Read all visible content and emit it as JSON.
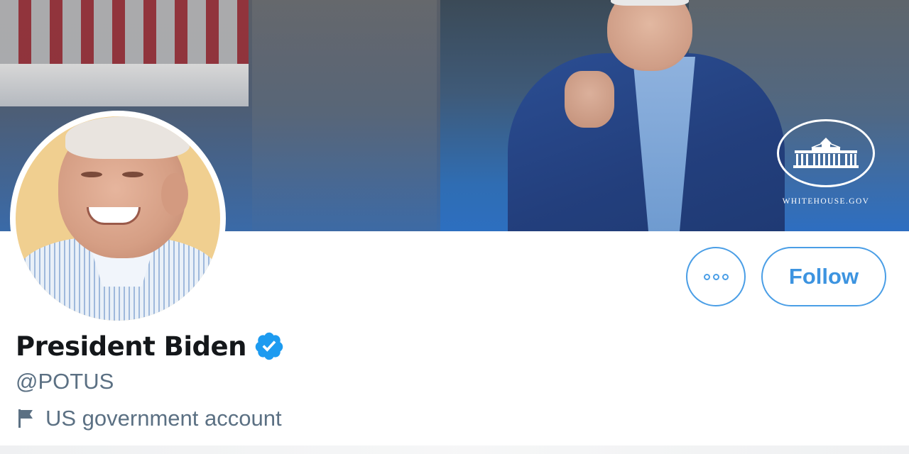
{
  "banner": {
    "watermark_text": "WHITEHOUSE.GOV"
  },
  "profile": {
    "display_name": "President Biden",
    "handle": "@POTUS",
    "account_label": "US government account",
    "verified": true
  },
  "actions": {
    "more_icon": "more-dots-icon",
    "follow_label": "Follow"
  },
  "colors": {
    "accent": "#4a9ee6",
    "verified_badge": "#1d9bf0",
    "name_text": "#14171a",
    "secondary_text": "#5b7083"
  }
}
